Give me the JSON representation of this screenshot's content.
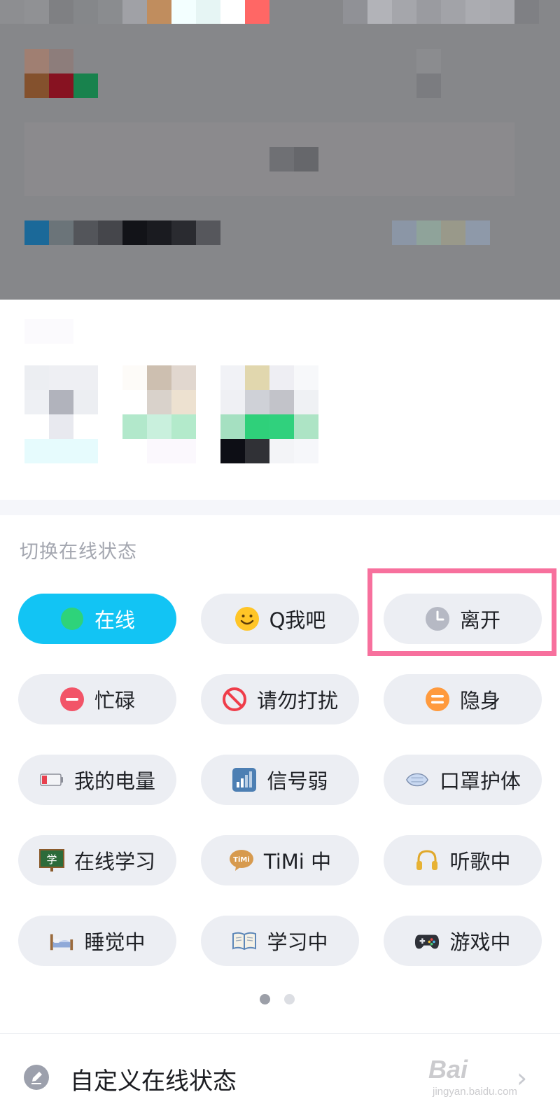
{
  "section_title": "切换在线状态",
  "statuses": [
    {
      "label": "在线",
      "icon": "online-dot-icon",
      "active": true
    },
    {
      "label": "Q我吧",
      "icon": "smiley-face-icon",
      "active": false
    },
    {
      "label": "离开",
      "icon": "clock-icon",
      "active": false
    },
    {
      "label": "忙碌",
      "icon": "minus-circle-icon",
      "active": false
    },
    {
      "label": "请勿打扰",
      "icon": "no-entry-icon",
      "active": false
    },
    {
      "label": "隐身",
      "icon": "hidden-circle-icon",
      "active": false
    },
    {
      "label": "我的电量",
      "icon": "battery-icon",
      "active": false
    },
    {
      "label": "信号弱",
      "icon": "signal-bars-icon",
      "active": false
    },
    {
      "label": "口罩护体",
      "icon": "face-mask-icon",
      "active": false
    },
    {
      "label": "在线学习",
      "icon": "blackboard-icon",
      "active": false
    },
    {
      "label": "TiMi 中",
      "icon": "timi-bubble-icon",
      "active": false
    },
    {
      "label": "听歌中",
      "icon": "headphones-icon",
      "active": false
    },
    {
      "label": "睡觉中",
      "icon": "bed-icon",
      "active": false
    },
    {
      "label": "学习中",
      "icon": "open-book-icon",
      "active": false
    },
    {
      "label": "游戏中",
      "icon": "gamepad-icon",
      "active": false
    }
  ],
  "pager": {
    "current": 1,
    "total": 2
  },
  "custom_status": {
    "label": "自定义在线状态"
  },
  "watermark": {
    "main": "Bai",
    "sub": "jingyan.baidu.com"
  },
  "colors": {
    "accent_online": "#12c4f4",
    "chip_bg": "#eceef3",
    "highlight_box": "#f7709d"
  }
}
